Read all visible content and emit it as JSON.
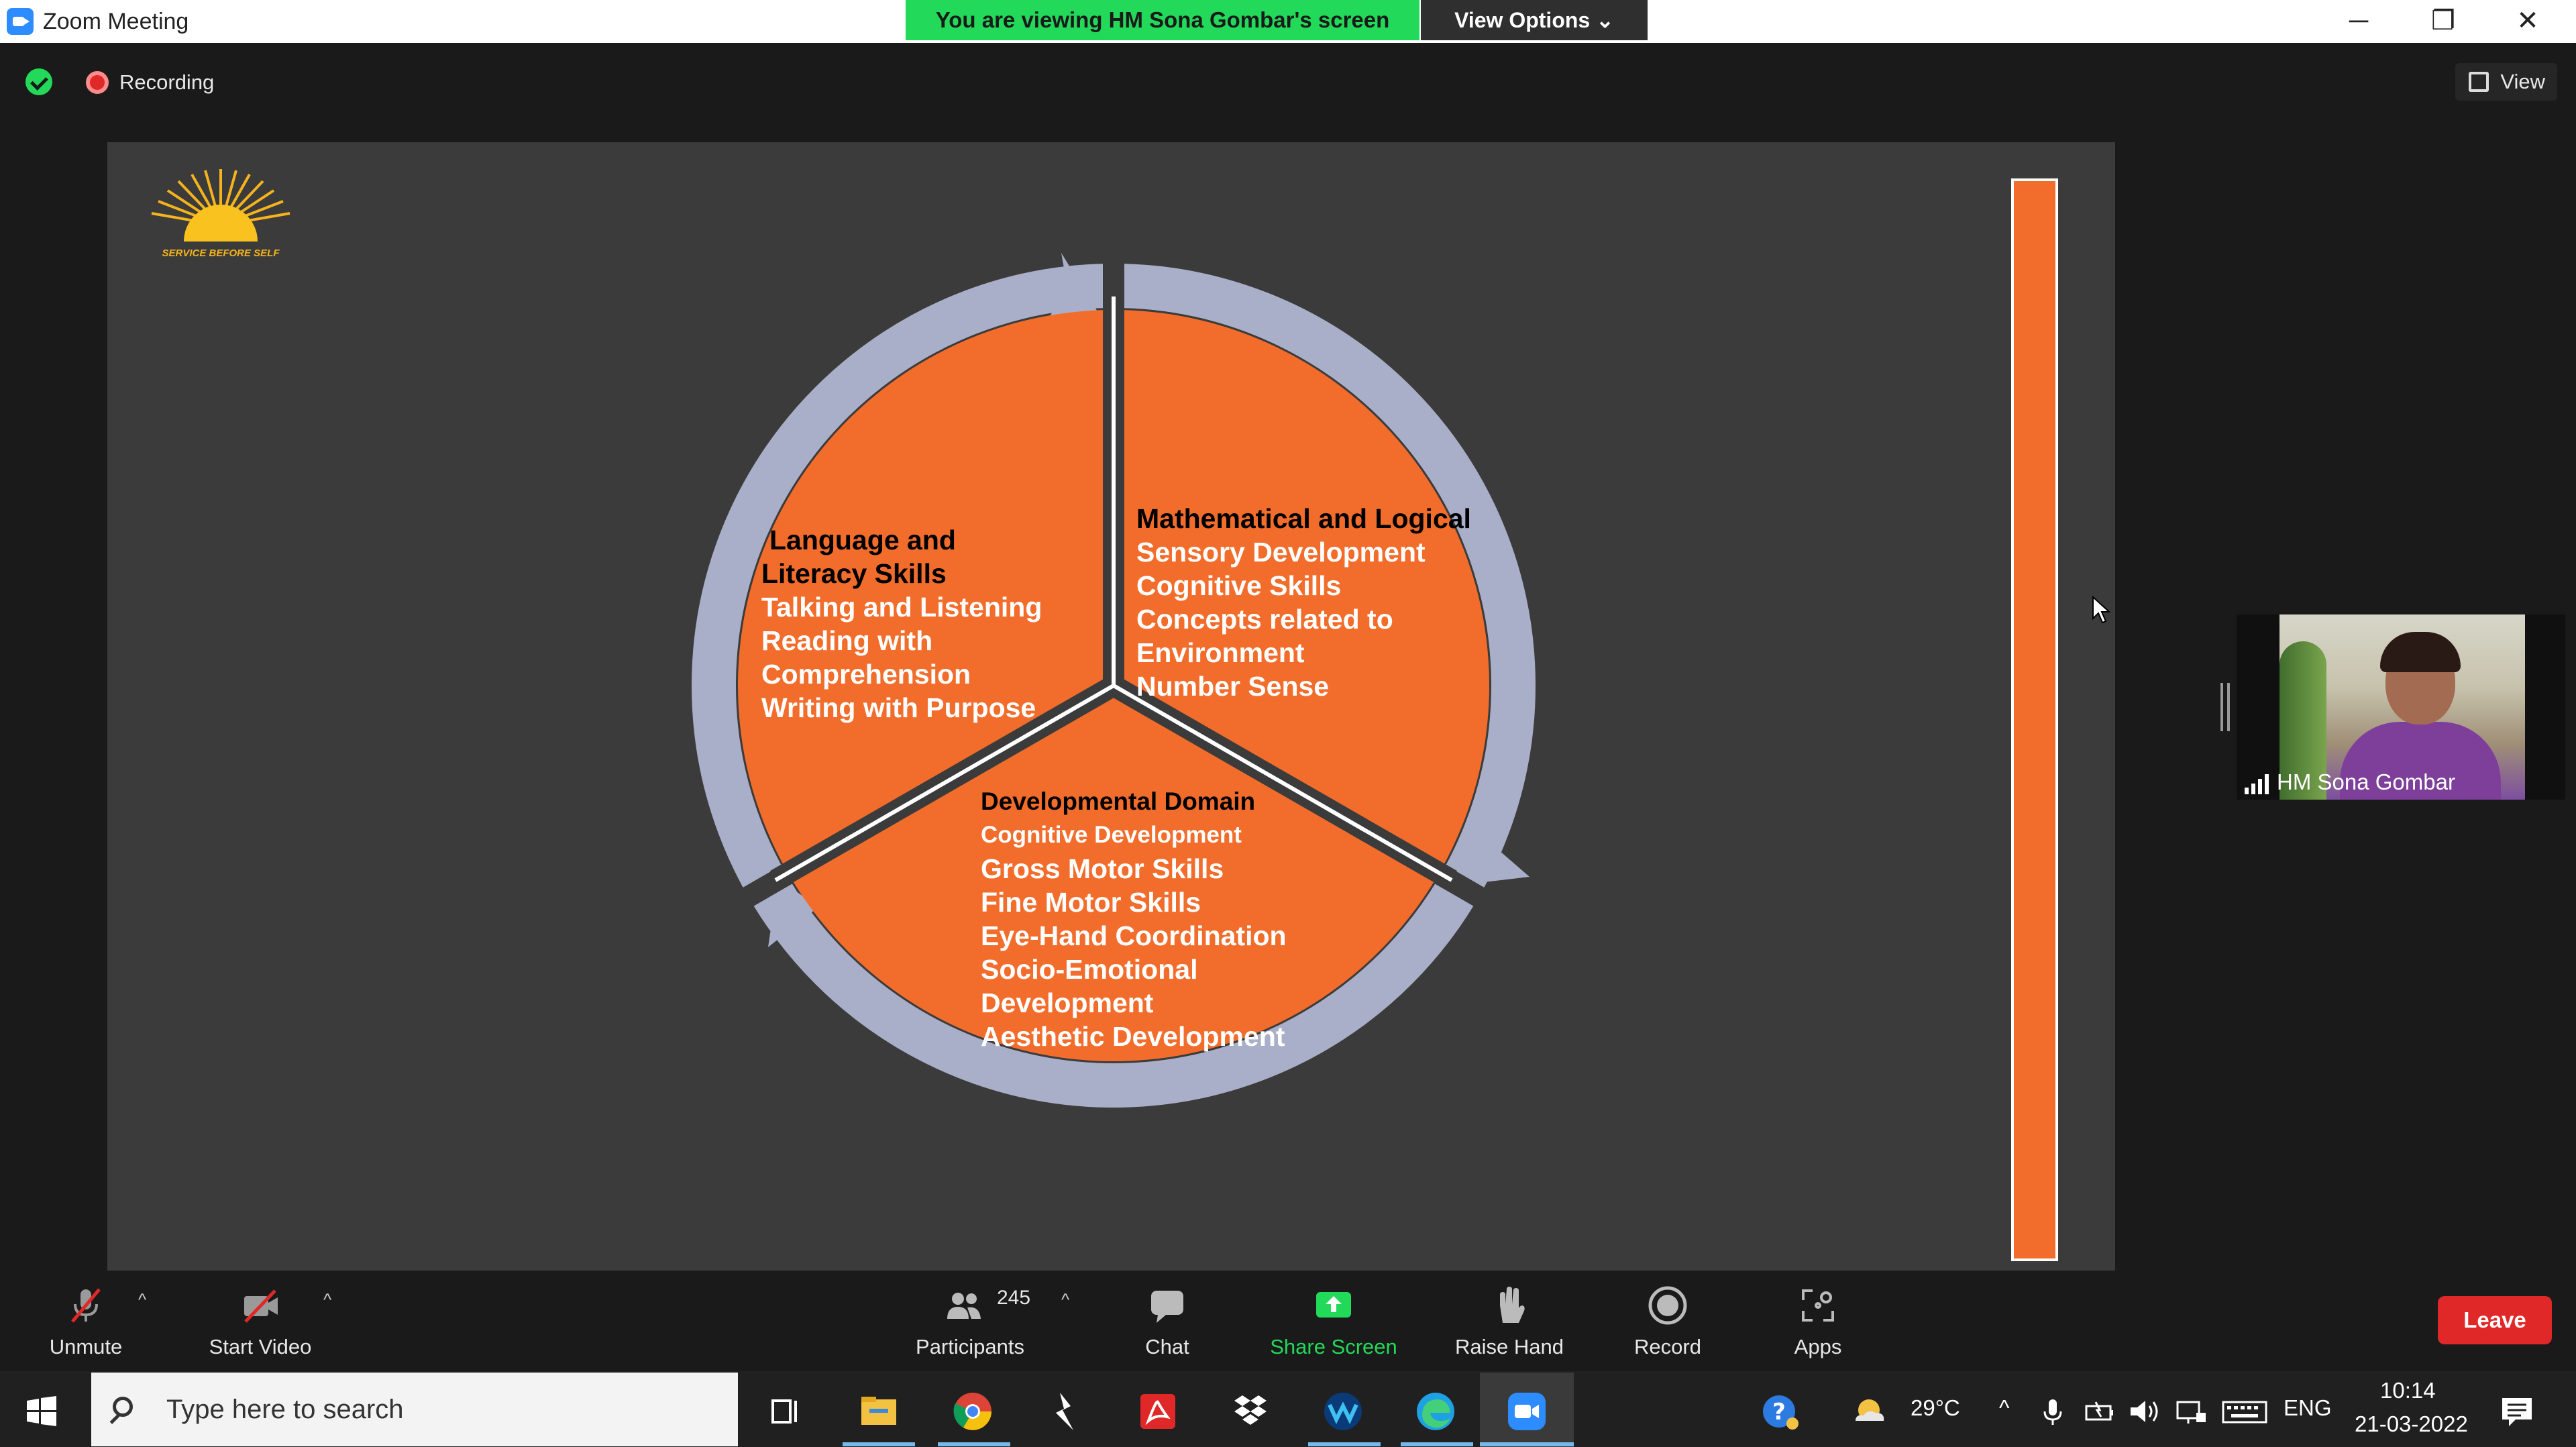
{
  "window": {
    "title": "Zoom Meeting"
  },
  "share_banner": {
    "text": "You are viewing HM Sona Gombar's screen",
    "options_label": "View Options ⌄"
  },
  "window_controls": {
    "minimize": "─",
    "restore": "❐",
    "close": "✕"
  },
  "meeting_bar": {
    "recording_label": "Recording",
    "view_label": "View"
  },
  "slide": {
    "logo_text": "SERVICE BEFORE SELF",
    "segments": [
      {
        "heading_1": "Language and",
        "heading_2": "Literacy Skills",
        "items": [
          "Talking and Listening",
          "Reading with",
          "Comprehension",
          "Writing with Purpose"
        ]
      },
      {
        "heading": "Mathematical and Logical",
        "items": [
          "Sensory Development",
          "Cognitive Skills",
          "Concepts related to",
          "Environment",
          "Number Sense"
        ]
      },
      {
        "heading": "Developmental Domain",
        "sub": "Cognitive Development",
        "items": [
          "Gross Motor Skills",
          "Fine Motor Skills",
          "Eye-Hand Coordination",
          "Socio-Emotional",
          "Development",
          "Aesthetic Development"
        ]
      }
    ],
    "colors": {
      "segment": "#F26D2C",
      "arrow": "#A9AFC8",
      "background": "#3B3B3B"
    }
  },
  "participant_tile": {
    "name": "HM Sona Gombar"
  },
  "toolbar": {
    "unmute": "Unmute",
    "start_video": "Start Video",
    "participants": "Participants",
    "participant_count": "245",
    "chat": "Chat",
    "share_screen": "Share Screen",
    "raise_hand": "Raise Hand",
    "record": "Record",
    "apps": "Apps",
    "leave": "Leave",
    "caret": "^"
  },
  "taskbar": {
    "search_placeholder": "Type here to search",
    "temperature": "29°C",
    "language": "ENG",
    "time": "10:14",
    "date": "21-03-2022",
    "tray_caret": "^"
  }
}
